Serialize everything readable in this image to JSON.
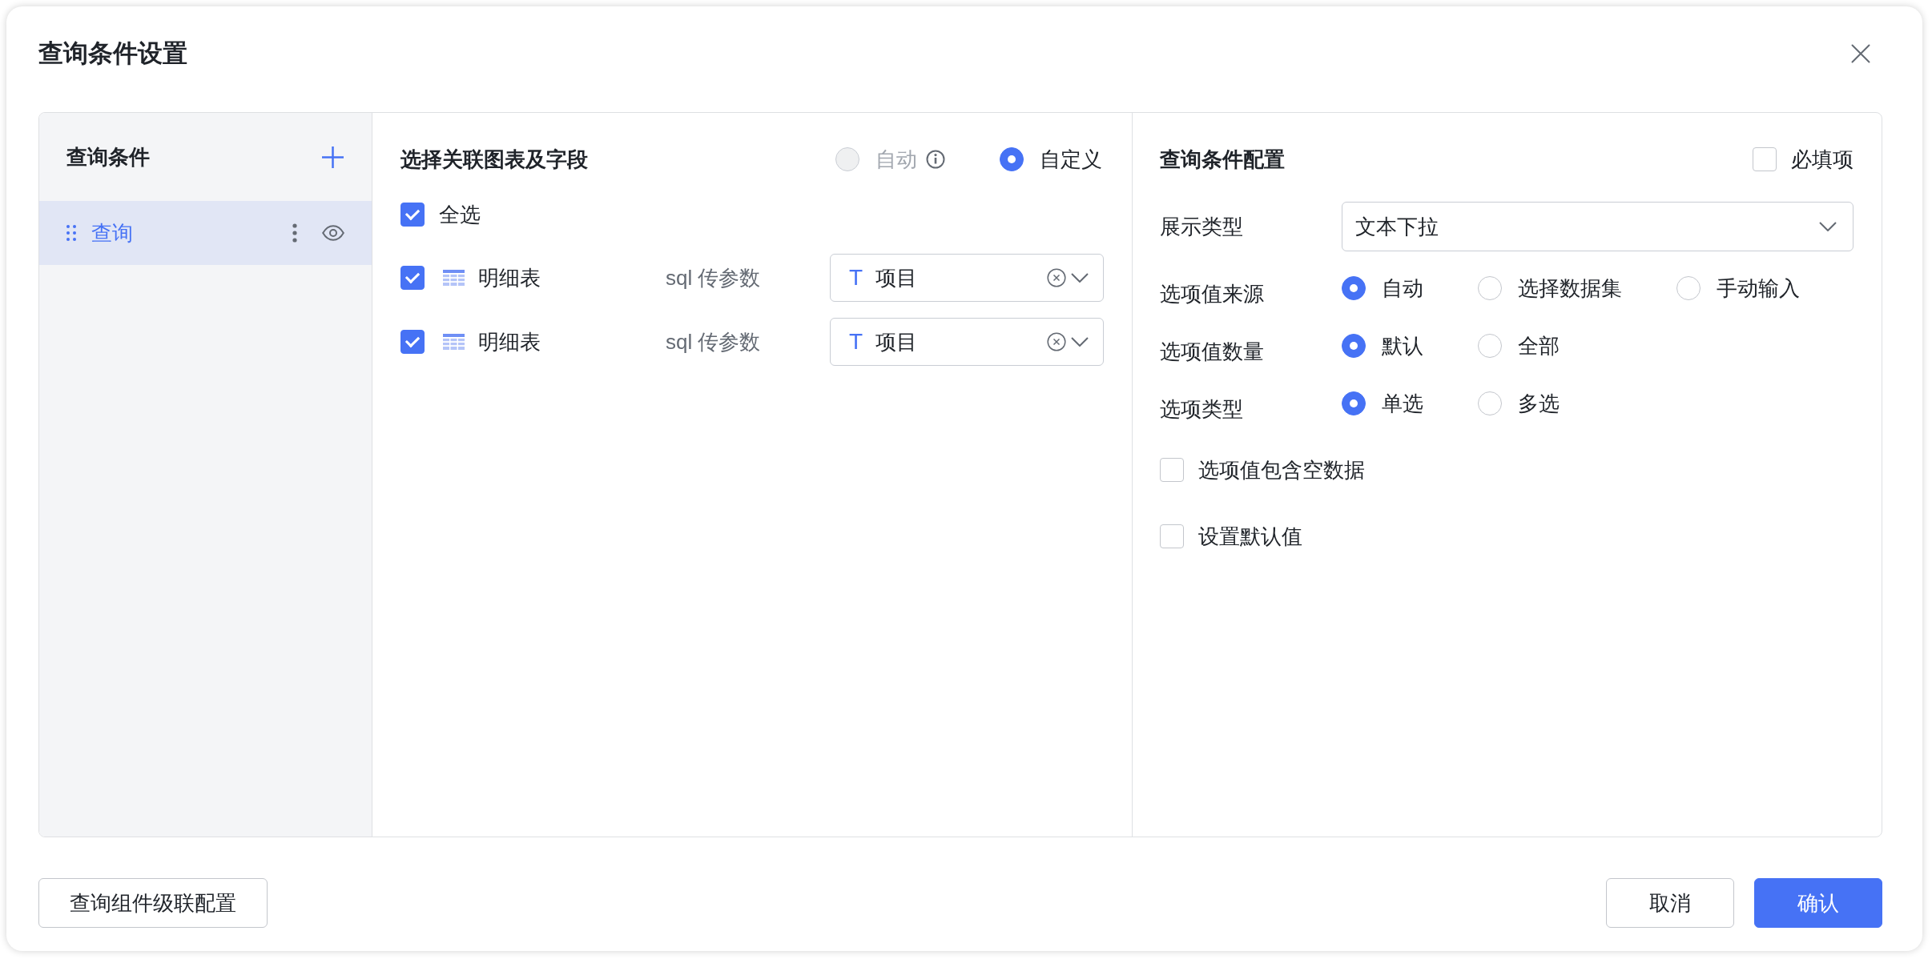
{
  "dialog": {
    "title": "查询条件设置"
  },
  "conditions_panel": {
    "title": "查询条件",
    "items": [
      {
        "label": "查询",
        "selected": true
      }
    ]
  },
  "link_panel": {
    "title": "选择关联图表及字段",
    "mode_options": [
      {
        "label": "自动",
        "selected": false,
        "disabled": true,
        "info": true
      },
      {
        "label": "自定义",
        "selected": true,
        "disabled": false,
        "info": false
      }
    ],
    "select_all": {
      "label": "全选",
      "checked": true
    },
    "rows": [
      {
        "checked": true,
        "chart": "明细表",
        "param": "sql 传参数",
        "type_icon": "T",
        "field": "项目"
      },
      {
        "checked": true,
        "chart": "明细表",
        "param": "sql 传参数",
        "type_icon": "T",
        "field": "项目"
      }
    ]
  },
  "config_panel": {
    "title": "查询条件配置",
    "required": {
      "label": "必填项",
      "checked": false
    },
    "display_type": {
      "label": "展示类型",
      "value": "文本下拉"
    },
    "radio_groups": [
      {
        "label": "选项值来源",
        "options": [
          {
            "label": "自动",
            "selected": true
          },
          {
            "label": "选择数据集",
            "selected": false
          },
          {
            "label": "手动输入",
            "selected": false
          }
        ]
      },
      {
        "label": "选项值数量",
        "options": [
          {
            "label": "默认",
            "selected": true
          },
          {
            "label": "全部",
            "selected": false
          }
        ]
      },
      {
        "label": "选项类型",
        "options": [
          {
            "label": "单选",
            "selected": true
          },
          {
            "label": "多选",
            "selected": false
          }
        ]
      }
    ],
    "checkboxes": [
      {
        "label": "选项值包含空数据",
        "checked": false
      },
      {
        "label": "设置默认值",
        "checked": false
      }
    ]
  },
  "footer": {
    "left_buttons": [
      {
        "label": "查询组件级联配置",
        "kind": "secondary"
      }
    ],
    "right_buttons": [
      {
        "label": "取消",
        "kind": "secondary"
      },
      {
        "label": "确认",
        "kind": "primary"
      }
    ]
  }
}
